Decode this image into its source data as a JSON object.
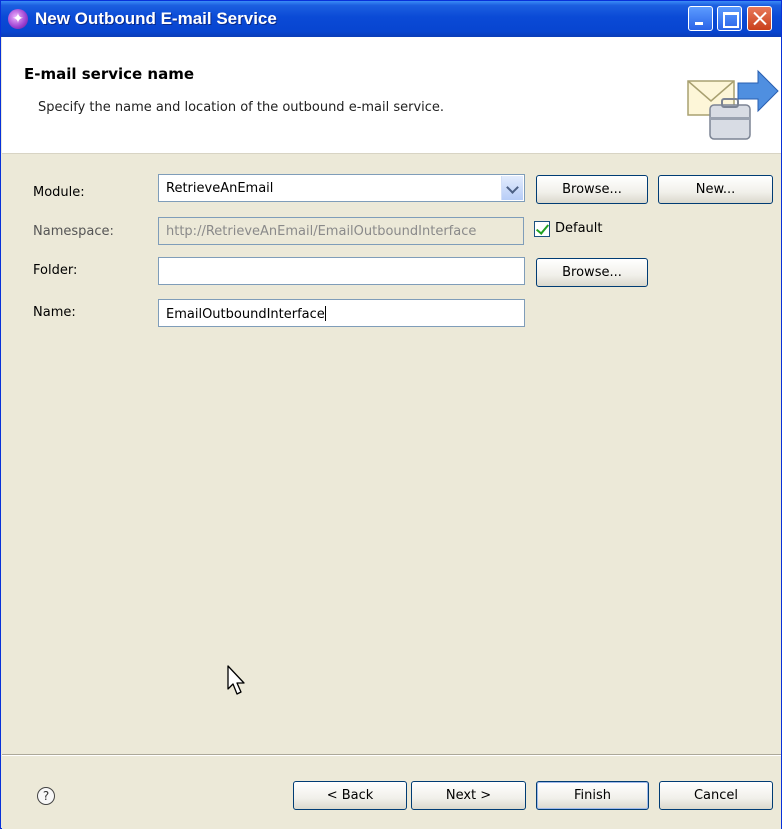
{
  "window": {
    "title": "New Outbound E-mail Service"
  },
  "header": {
    "title": "E-mail service name",
    "description": "Specify the name and location of the outbound e-mail service."
  },
  "form": {
    "module": {
      "label": "Module:",
      "value": "RetrieveAnEmail"
    },
    "namespace": {
      "label": "Namespace:",
      "value": "http://RetrieveAnEmail/EmailOutboundInterface",
      "default_label": "Default",
      "default_checked": true
    },
    "folder": {
      "label": "Folder:",
      "value": ""
    },
    "name": {
      "label": "Name:",
      "value": "EmailOutboundInterface"
    },
    "browse_label": "Browse...",
    "new_label": "New..."
  },
  "footer": {
    "help_glyph": "?",
    "back_label": "< Back",
    "next_label": "Next >",
    "finish_label": "Finish",
    "cancel_label": "Cancel"
  },
  "colors": {
    "titlebar": "#0a4ad6",
    "dialog_bg": "#ece9d8",
    "button_border": "#003c74"
  }
}
